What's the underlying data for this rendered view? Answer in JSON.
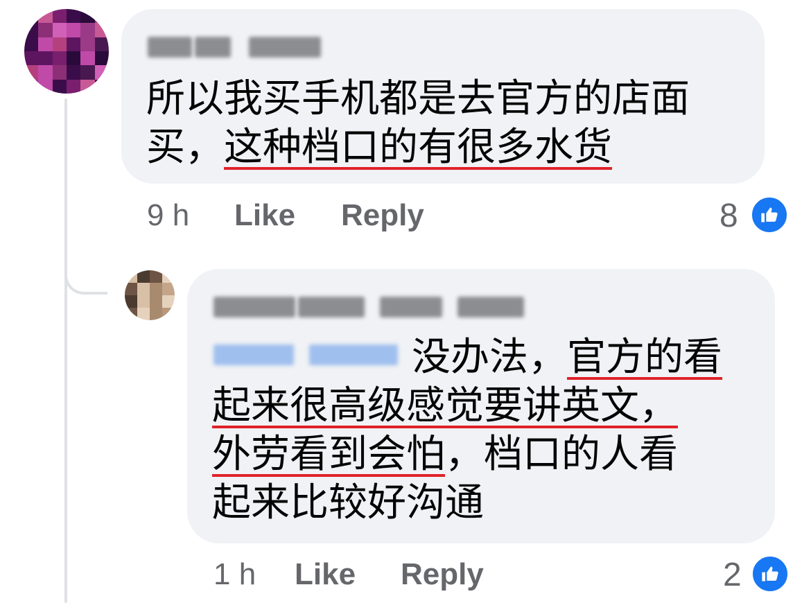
{
  "comments": [
    {
      "author_blurred": "Chun Sen",
      "text_line1": "所以我买手机都是去官方的店面",
      "text_line2_prefix": "买，",
      "text_line2_underlined": "这种档口的有很多水货",
      "time": "9 h",
      "like_label": "Like",
      "reply_label": "Reply",
      "reaction_count": "8",
      "reaction_icon": "thumbs-up-icon"
    },
    {
      "author_blurred": "Nicholas Pop Pop",
      "mention_blurred": "Chun Sen",
      "text_line1_prefix": "没办法，",
      "text_line1_underlined": "官方的看",
      "text_line2_underlined": "起来很高级感觉要讲英文，",
      "text_line3_underlined": "外劳看到会怕",
      "text_line3_suffix": "，档口的人看",
      "text_line4": "起来比较好沟通",
      "time": "1 h",
      "like_label": "Like",
      "reply_label": "Reply",
      "reaction_count": "2",
      "reaction_icon": "thumbs-up-icon"
    }
  ],
  "colors": {
    "bubble": "#f0f2f5",
    "meta_text": "#65676b",
    "body_text": "#050505",
    "like_badge": "#1877f2",
    "underline": "#e0222a",
    "mention": "#9fbfee"
  }
}
